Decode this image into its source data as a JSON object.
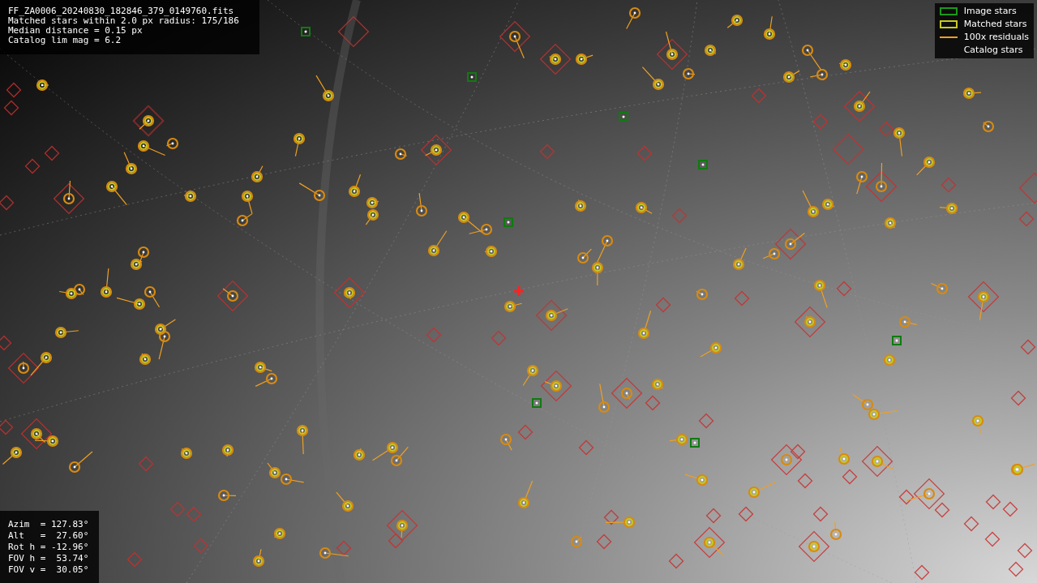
{
  "info": {
    "lines": [
      "FF_ZA0006_20240830_182846_379_0149760.fits",
      "Matched stars within 2.0 px radius: 175/186",
      "Median distance = 0.15 px",
      "Catalog lim mag = 6.2"
    ]
  },
  "legend": [
    {
      "label": "Image stars",
      "kind": "box",
      "color": "#1a9a1a"
    },
    {
      "label": "Matched stars",
      "kind": "box",
      "color": "#c8c820"
    },
    {
      "label": "100x residuals",
      "kind": "line",
      "color": "#f0a020"
    },
    {
      "label": "Catalog stars",
      "kind": "blank"
    }
  ],
  "pointing": {
    "lines": [
      "Azim  = 127.83°",
      "Alt   =  27.60°",
      "Rot h = -12.96°",
      "FOV h =  53.74°",
      "FOV v =  30.05°"
    ]
  }
}
